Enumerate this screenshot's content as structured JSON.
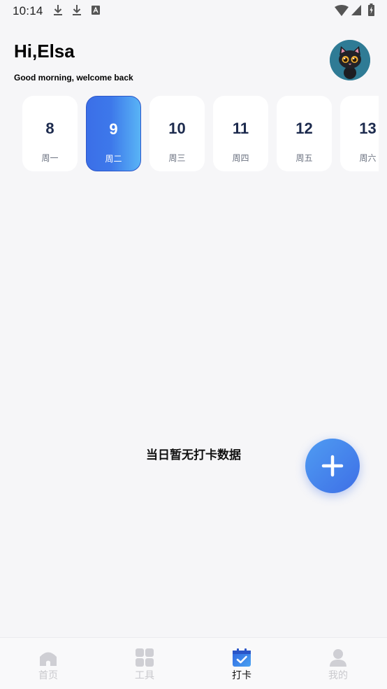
{
  "status_bar": {
    "time": "10:14"
  },
  "header": {
    "greeting": "Hi,Elsa",
    "subtitle": "Good morning, welcome back"
  },
  "days": [
    {
      "num": "8",
      "weekday": "周一",
      "selected": false
    },
    {
      "num": "9",
      "weekday": "周二",
      "selected": true
    },
    {
      "num": "10",
      "weekday": "周三",
      "selected": false
    },
    {
      "num": "11",
      "weekday": "周四",
      "selected": false
    },
    {
      "num": "12",
      "weekday": "周五",
      "selected": false
    },
    {
      "num": "13",
      "weekday": "周六",
      "selected": false
    }
  ],
  "empty_state": {
    "text": "当日暂无打卡数据"
  },
  "bottom_nav": [
    {
      "label": "首页",
      "icon": "home-icon",
      "active": false
    },
    {
      "label": "工具",
      "icon": "grid-icon",
      "active": false
    },
    {
      "label": "打卡",
      "icon": "calendar-check-icon",
      "active": true
    },
    {
      "label": "我的",
      "icon": "person-icon",
      "active": false
    }
  ],
  "colors": {
    "accent": "#3b6fe8",
    "accent_light": "#59b4f6",
    "background": "#f6f6f8"
  }
}
